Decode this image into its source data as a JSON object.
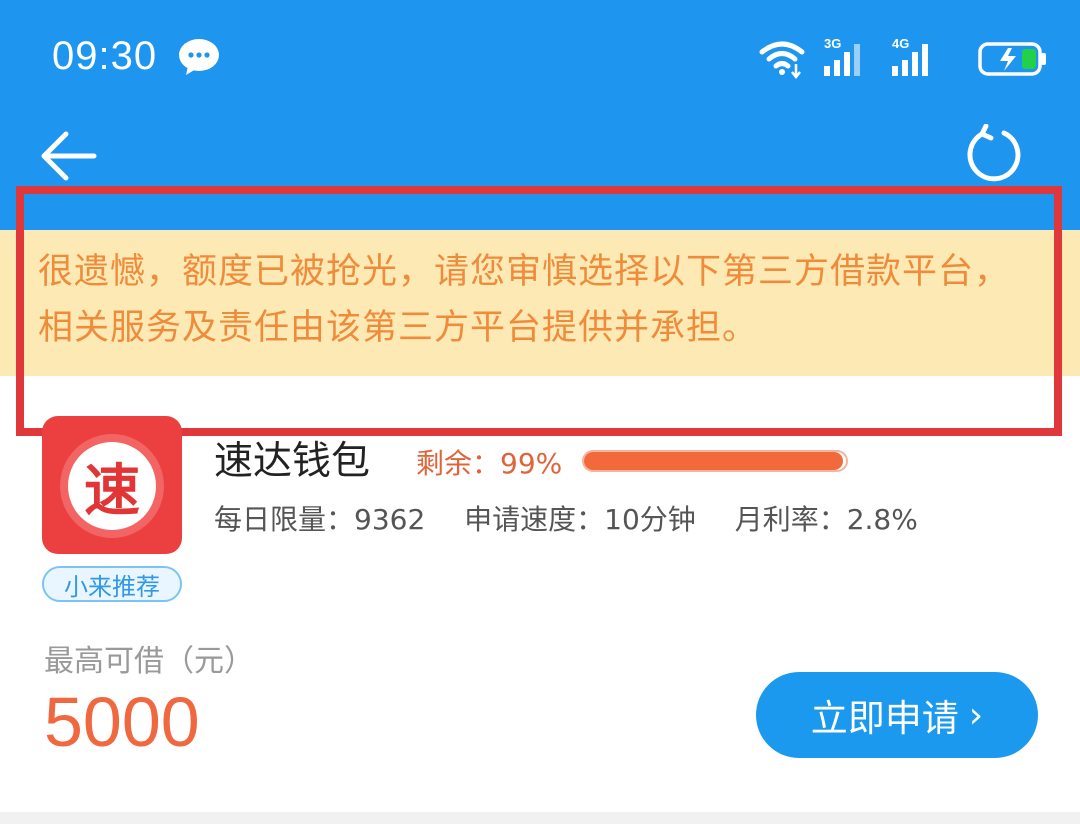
{
  "status_bar": {
    "time": "09:30",
    "sim1_label": "3G",
    "sim2_label": "4G",
    "icons": [
      "chat-bubble-icon",
      "wifi-icon",
      "signal-3g-icon",
      "signal-4g-icon",
      "battery-charging-icon"
    ]
  },
  "nav": {
    "back_icon": "back-arrow-icon",
    "refresh_icon": "refresh-icon"
  },
  "notice": {
    "text": "很遗憾，额度已被抢光，请您审慎选择以下第三方借款平台，相关服务及责任由该第三方平台提供并承担。"
  },
  "product": {
    "icon_char": "速",
    "tag": "小来推荐",
    "name": "速达钱包",
    "remain_label": "剩余：99%",
    "remain_fraction": 0.99,
    "daily_limit": "每日限量：9362",
    "apply_speed": "申请速度：10分钟",
    "monthly_rate": "月利率：2.8%",
    "max_label": "最高可借（元）",
    "max_amount": "5000",
    "apply_button": "立即申请"
  },
  "colors": {
    "header_blue": "#1e95ef",
    "banner_yellow": "#fde9b3",
    "notice_orange": "#ef8c3c",
    "highlight_red": "#e0383a",
    "amount_orange": "#f06840",
    "button_blue": "#1a99ee"
  }
}
